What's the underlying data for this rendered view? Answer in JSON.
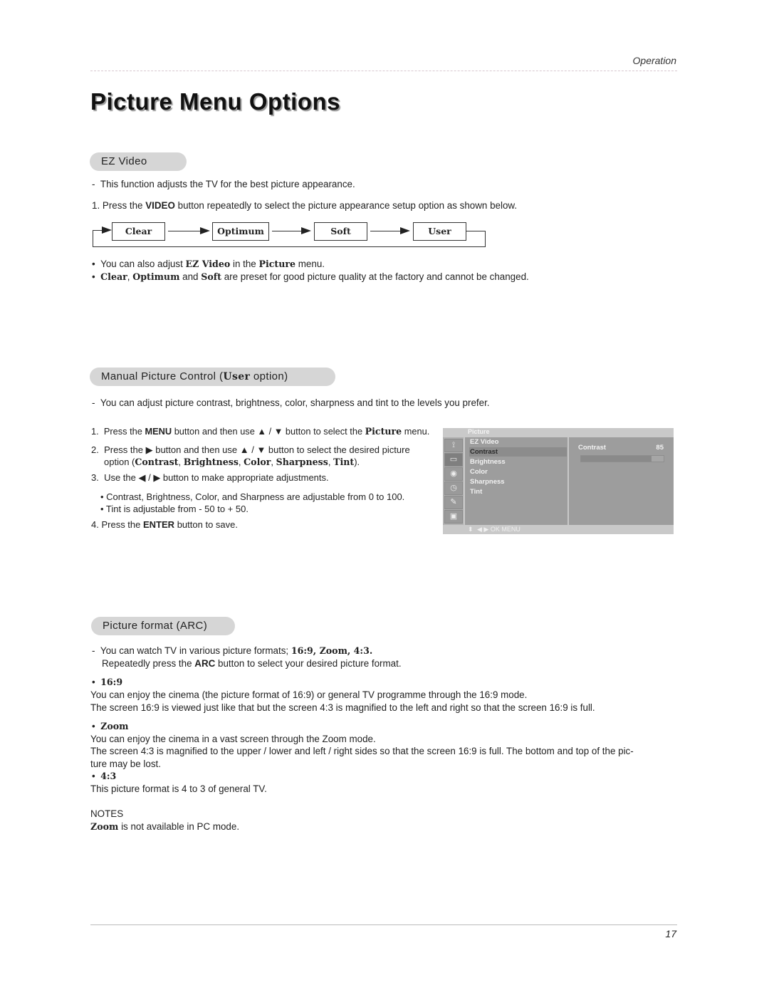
{
  "header": {
    "section": "Operation"
  },
  "title": "Picture Menu Options",
  "ez_video": {
    "heading": "EZ Video",
    "intro": "This function adjusts the TV for the best picture appearance.",
    "step1": {
      "num": "1.",
      "pre": "Press the",
      "key": "VIDEO",
      "post": "button repeatedly to select the picture appearance setup option as shown below."
    },
    "flow": [
      "Clear",
      "Optimum",
      "Soft",
      "User"
    ],
    "bullet1": {
      "pre": "You can also adjust",
      "b1": "EZ Video",
      "mid": "in the",
      "b2": "Picture",
      "post": "menu."
    },
    "bullet2": {
      "b1": "Clear",
      "sep1": ",",
      "b2": "Optimum",
      "mid": "and",
      "b3": "Soft",
      "post": "are preset for good picture quality at the factory and cannot be changed."
    }
  },
  "manual": {
    "heading_pre": "Manual Picture Control (",
    "heading_bold": "User",
    "heading_post": " option)",
    "intro": "You can adjust picture contrast, brightness, color, sharpness and tint to the levels you prefer.",
    "step1": {
      "num": "1.",
      "pre": "Press the",
      "key": "MENU",
      "mid": "button and then use ▲ / ▼ button to select the",
      "b": "Picture",
      "post": "menu."
    },
    "step2": {
      "num": "2.",
      "line1": "Press the ▶  button and then use ▲ / ▼ button to select the desired picture",
      "pre": "option (",
      "opts": [
        "Contrast",
        "Brightness",
        "Color",
        "Sharpness",
        "Tint"
      ],
      "post": ")."
    },
    "step3": {
      "num": "3.",
      "text": "Use the ◀ / ▶ button to make appropriate adjustments."
    },
    "note1": "• Contrast, Brightness, Color, and Sharpness are adjustable from 0 to 100.",
    "note2": "• Tint is adjustable from - 50 to + 50.",
    "step4": {
      "num": "4.",
      "pre": "Press the",
      "key": "ENTER",
      "post": "button to save."
    }
  },
  "osd": {
    "title": "Picture",
    "icons": [
      "antenna-icon",
      "picture-icon",
      "speaker-icon",
      "clock-icon",
      "tools-icon",
      "pc-icon"
    ],
    "items": [
      "EZ Video",
      "Contrast",
      "Brightness",
      "Color",
      "Sharpness",
      "Tint"
    ],
    "selected": "Contrast",
    "value_label": "Contrast",
    "value": "85",
    "level_fraction": 0.85,
    "nav_hint": "◀ ▶  OK    MENU"
  },
  "arc": {
    "heading": "Picture format (ARC)",
    "intro_pre": "You can watch TV in various picture formats;",
    "intro_bold": "16:9, Zoom, 4:3.",
    "intro2_pre": "Repeatedly press the",
    "intro2_key": "ARC",
    "intro2_post": "button to select your desired picture format.",
    "f169": {
      "label": "16:9",
      "l1": "You can enjoy the cinema (the picture format of 16:9) or general TV programme through the 16:9 mode.",
      "l2": "The screen 16:9 is viewed just like that but the screen 4:3 is magnified to the left and right so that the screen 16:9 is full."
    },
    "zoom": {
      "label": "Zoom",
      "l1": "You can enjoy the cinema in a vast screen through the Zoom mode.",
      "l2": "The screen 4:3 is magnified to the upper / lower and left / right sides so that the screen 16:9 is full. The bottom and top of the pic-",
      "l3": "ture may be lost."
    },
    "f43": {
      "label": "4:3",
      "l1": "This picture format is 4 to 3 of general TV."
    },
    "notes_label": "NOTES",
    "note_bold": "Zoom",
    "note_post": "is not available in PC mode."
  },
  "footer": {
    "page": "17"
  }
}
